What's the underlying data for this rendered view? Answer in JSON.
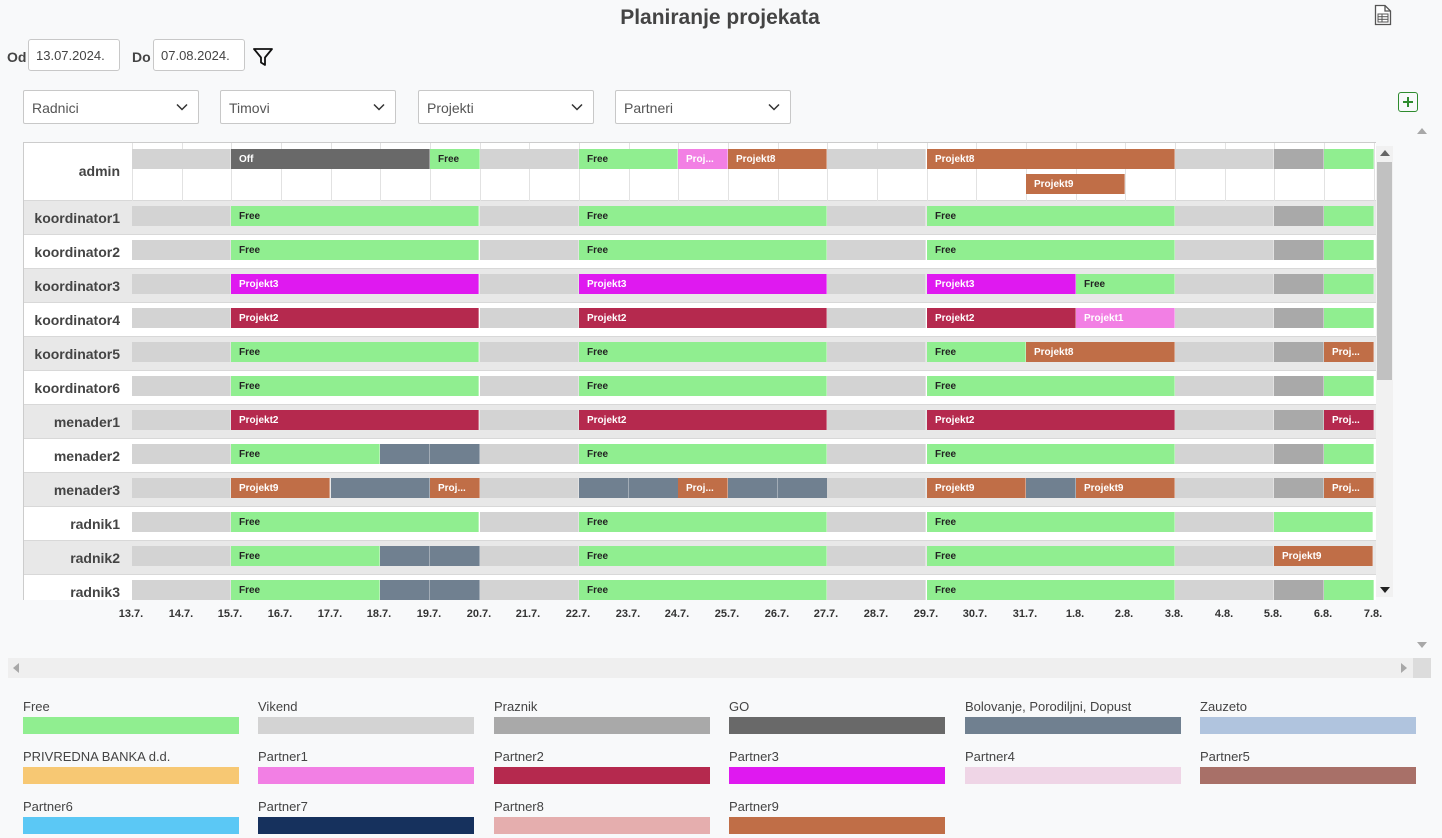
{
  "title": "Planiranje projekata",
  "icons": {
    "export": "excel-export-icon",
    "filter": "filter-icon",
    "add": "add-icon"
  },
  "filters": {
    "od_label": "Od",
    "do_label": "Do",
    "od_value": "13.07.2024.",
    "do_value": "07.08.2024.",
    "dropdowns": [
      "Radnici",
      "Timovi",
      "Projekti",
      "Partneri"
    ]
  },
  "colors": {
    "free": "#90ee90",
    "vikend": "#d3d3d3",
    "praznik": "#a9a9a9",
    "go": "#696969",
    "bolovanje": "#708090",
    "zauzeto": "#b0c4de",
    "privredna": "#f7c873",
    "partner1": "#f27fe4",
    "partner2": "#b5294e",
    "partner3": "#df19f0",
    "partner4": "#efd5e6",
    "partner5": "#a87068",
    "partner6": "#5bc8f5",
    "partner7": "#16315d",
    "partner8": "#e5aeae",
    "partner9": "#c06e47"
  },
  "axis_dates": [
    "13.7.",
    "14.7.",
    "15.7.",
    "16.7.",
    "17.7.",
    "18.7.",
    "19.7.",
    "20.7.",
    "21.7.",
    "22.7.",
    "23.7.",
    "24.7.",
    "25.7.",
    "26.7.",
    "27.7.",
    "28.7.",
    "29.7.",
    "30.7.",
    "31.7.",
    "1.8.",
    "2.8.",
    "3.8.",
    "4.8.",
    "5.8.",
    "6.8.",
    "7.8."
  ],
  "rows": [
    {
      "name": "admin",
      "lanes": [
        [
          {
            "s": 0,
            "e": 2,
            "t": "vikend",
            "l": ""
          },
          {
            "s": 2,
            "e": 6,
            "t": "go",
            "l": "Off"
          },
          {
            "s": 6,
            "e": 7,
            "t": "free",
            "l": "Free"
          },
          {
            "s": 7,
            "e": 9,
            "t": "vikend",
            "l": ""
          },
          {
            "s": 9,
            "e": 11,
            "t": "free",
            "l": "Free"
          },
          {
            "s": 11,
            "e": 12,
            "t": "partner1",
            "l": "Proj..."
          },
          {
            "s": 12,
            "e": 14,
            "t": "partner9",
            "l": "Projekt8"
          },
          {
            "s": 14,
            "e": 16,
            "t": "vikend",
            "l": ""
          },
          {
            "s": 16,
            "e": 21,
            "t": "partner9",
            "l": "Projekt8"
          },
          {
            "s": 21,
            "e": 23,
            "t": "vikend",
            "l": ""
          },
          {
            "s": 23,
            "e": 24,
            "t": "praznik",
            "l": ""
          },
          {
            "s": 24,
            "e": 25,
            "t": "free",
            "l": ""
          }
        ],
        [
          {
            "s": 18,
            "e": 20,
            "t": "partner9",
            "l": "Projekt9"
          }
        ]
      ]
    },
    {
      "name": "koordinator1",
      "lanes": [
        [
          {
            "s": 0,
            "e": 2,
            "t": "vikend",
            "l": ""
          },
          {
            "s": 2,
            "e": 7,
            "t": "free",
            "l": "Free"
          },
          {
            "s": 7,
            "e": 9,
            "t": "vikend",
            "l": ""
          },
          {
            "s": 9,
            "e": 14,
            "t": "free",
            "l": "Free"
          },
          {
            "s": 14,
            "e": 16,
            "t": "vikend",
            "l": ""
          },
          {
            "s": 16,
            "e": 21,
            "t": "free",
            "l": "Free"
          },
          {
            "s": 21,
            "e": 23,
            "t": "vikend",
            "l": ""
          },
          {
            "s": 23,
            "e": 24,
            "t": "praznik",
            "l": ""
          },
          {
            "s": 24,
            "e": 25,
            "t": "free",
            "l": ""
          }
        ]
      ]
    },
    {
      "name": "koordinator2",
      "lanes": [
        [
          {
            "s": 0,
            "e": 2,
            "t": "vikend",
            "l": ""
          },
          {
            "s": 2,
            "e": 7,
            "t": "free",
            "l": "Free"
          },
          {
            "s": 7,
            "e": 9,
            "t": "vikend",
            "l": ""
          },
          {
            "s": 9,
            "e": 14,
            "t": "free",
            "l": "Free"
          },
          {
            "s": 14,
            "e": 16,
            "t": "vikend",
            "l": ""
          },
          {
            "s": 16,
            "e": 21,
            "t": "free",
            "l": "Free"
          },
          {
            "s": 21,
            "e": 23,
            "t": "vikend",
            "l": ""
          },
          {
            "s": 23,
            "e": 24,
            "t": "praznik",
            "l": ""
          },
          {
            "s": 24,
            "e": 25,
            "t": "free",
            "l": ""
          }
        ]
      ]
    },
    {
      "name": "koordinator3",
      "lanes": [
        [
          {
            "s": 0,
            "e": 2,
            "t": "vikend",
            "l": ""
          },
          {
            "s": 2,
            "e": 7,
            "t": "partner3",
            "l": "Projekt3"
          },
          {
            "s": 7,
            "e": 9,
            "t": "vikend",
            "l": ""
          },
          {
            "s": 9,
            "e": 14,
            "t": "partner3",
            "l": "Projekt3"
          },
          {
            "s": 14,
            "e": 16,
            "t": "vikend",
            "l": ""
          },
          {
            "s": 16,
            "e": 19,
            "t": "partner3",
            "l": "Projekt3"
          },
          {
            "s": 19,
            "e": 21,
            "t": "free",
            "l": "Free"
          },
          {
            "s": 21,
            "e": 23,
            "t": "vikend",
            "l": ""
          },
          {
            "s": 23,
            "e": 24,
            "t": "praznik",
            "l": ""
          },
          {
            "s": 24,
            "e": 25,
            "t": "free",
            "l": ""
          }
        ]
      ]
    },
    {
      "name": "koordinator4",
      "lanes": [
        [
          {
            "s": 0,
            "e": 2,
            "t": "vikend",
            "l": ""
          },
          {
            "s": 2,
            "e": 7,
            "t": "partner2",
            "l": "Projekt2"
          },
          {
            "s": 7,
            "e": 9,
            "t": "vikend",
            "l": ""
          },
          {
            "s": 9,
            "e": 14,
            "t": "partner2",
            "l": "Projekt2"
          },
          {
            "s": 14,
            "e": 16,
            "t": "vikend",
            "l": ""
          },
          {
            "s": 16,
            "e": 19,
            "t": "partner2",
            "l": "Projekt2"
          },
          {
            "s": 19,
            "e": 21,
            "t": "partner1",
            "l": "Projekt1"
          },
          {
            "s": 21,
            "e": 23,
            "t": "vikend",
            "l": ""
          },
          {
            "s": 23,
            "e": 24,
            "t": "praznik",
            "l": ""
          },
          {
            "s": 24,
            "e": 25,
            "t": "free",
            "l": ""
          }
        ]
      ]
    },
    {
      "name": "koordinator5",
      "lanes": [
        [
          {
            "s": 0,
            "e": 2,
            "t": "vikend",
            "l": ""
          },
          {
            "s": 2,
            "e": 7,
            "t": "free",
            "l": "Free"
          },
          {
            "s": 7,
            "e": 9,
            "t": "vikend",
            "l": ""
          },
          {
            "s": 9,
            "e": 14,
            "t": "free",
            "l": "Free"
          },
          {
            "s": 14,
            "e": 16,
            "t": "vikend",
            "l": ""
          },
          {
            "s": 16,
            "e": 18,
            "t": "free",
            "l": "Free"
          },
          {
            "s": 18,
            "e": 21,
            "t": "partner9",
            "l": "Projekt8"
          },
          {
            "s": 21,
            "e": 23,
            "t": "vikend",
            "l": ""
          },
          {
            "s": 23,
            "e": 24,
            "t": "praznik",
            "l": ""
          },
          {
            "s": 24,
            "e": 25,
            "t": "partner9",
            "l": "Proj..."
          }
        ]
      ]
    },
    {
      "name": "koordinator6",
      "lanes": [
        [
          {
            "s": 0,
            "e": 2,
            "t": "vikend",
            "l": ""
          },
          {
            "s": 2,
            "e": 7,
            "t": "free",
            "l": "Free"
          },
          {
            "s": 7,
            "e": 9,
            "t": "vikend",
            "l": ""
          },
          {
            "s": 9,
            "e": 14,
            "t": "free",
            "l": "Free"
          },
          {
            "s": 14,
            "e": 16,
            "t": "vikend",
            "l": ""
          },
          {
            "s": 16,
            "e": 21,
            "t": "free",
            "l": "Free"
          },
          {
            "s": 21,
            "e": 23,
            "t": "vikend",
            "l": ""
          },
          {
            "s": 23,
            "e": 24,
            "t": "praznik",
            "l": ""
          },
          {
            "s": 24,
            "e": 25,
            "t": "free",
            "l": ""
          }
        ]
      ]
    },
    {
      "name": "menader1",
      "lanes": [
        [
          {
            "s": 0,
            "e": 2,
            "t": "vikend",
            "l": ""
          },
          {
            "s": 2,
            "e": 7,
            "t": "partner2",
            "l": "Projekt2"
          },
          {
            "s": 7,
            "e": 9,
            "t": "vikend",
            "l": ""
          },
          {
            "s": 9,
            "e": 14,
            "t": "partner2",
            "l": "Projekt2"
          },
          {
            "s": 14,
            "e": 16,
            "t": "vikend",
            "l": ""
          },
          {
            "s": 16,
            "e": 21,
            "t": "partner2",
            "l": "Projekt2"
          },
          {
            "s": 21,
            "e": 23,
            "t": "vikend",
            "l": ""
          },
          {
            "s": 23,
            "e": 24,
            "t": "praznik",
            "l": ""
          },
          {
            "s": 24,
            "e": 25,
            "t": "partner2",
            "l": "Proj..."
          }
        ]
      ]
    },
    {
      "name": "menader2",
      "lanes": [
        [
          {
            "s": 0,
            "e": 2,
            "t": "vikend",
            "l": ""
          },
          {
            "s": 2,
            "e": 5,
            "t": "free",
            "l": "Free"
          },
          {
            "s": 5,
            "e": 6,
            "t": "bolovanje",
            "l": ""
          },
          {
            "s": 6,
            "e": 7,
            "t": "bolovanje",
            "l": ""
          },
          {
            "s": 7,
            "e": 9,
            "t": "vikend",
            "l": ""
          },
          {
            "s": 9,
            "e": 14,
            "t": "free",
            "l": "Free"
          },
          {
            "s": 14,
            "e": 16,
            "t": "vikend",
            "l": ""
          },
          {
            "s": 16,
            "e": 21,
            "t": "free",
            "l": "Free"
          },
          {
            "s": 21,
            "e": 23,
            "t": "vikend",
            "l": ""
          },
          {
            "s": 23,
            "e": 24,
            "t": "praznik",
            "l": ""
          },
          {
            "s": 24,
            "e": 25,
            "t": "free",
            "l": ""
          }
        ]
      ]
    },
    {
      "name": "menader3",
      "lanes": [
        [
          {
            "s": 0,
            "e": 2,
            "t": "vikend",
            "l": ""
          },
          {
            "s": 2,
            "e": 4,
            "t": "partner9",
            "l": "Projekt9"
          },
          {
            "s": 4,
            "e": 5,
            "t": "bolovanje",
            "l": ""
          },
          {
            "s": 5,
            "e": 6,
            "t": "bolovanje",
            "l": ""
          },
          {
            "s": 6,
            "e": 7,
            "t": "partner9",
            "l": "Proj..."
          },
          {
            "s": 7,
            "e": 9,
            "t": "vikend",
            "l": ""
          },
          {
            "s": 9,
            "e": 10,
            "t": "bolovanje",
            "l": ""
          },
          {
            "s": 10,
            "e": 11,
            "t": "bolovanje",
            "l": ""
          },
          {
            "s": 11,
            "e": 12,
            "t": "partner9",
            "l": "Proj..."
          },
          {
            "s": 12,
            "e": 13,
            "t": "bolovanje",
            "l": ""
          },
          {
            "s": 13,
            "e": 14,
            "t": "bolovanje",
            "l": ""
          },
          {
            "s": 14,
            "e": 16,
            "t": "vikend",
            "l": ""
          },
          {
            "s": 16,
            "e": 18,
            "t": "partner9",
            "l": "Projekt9"
          },
          {
            "s": 18,
            "e": 19,
            "t": "bolovanje",
            "l": ""
          },
          {
            "s": 19,
            "e": 21,
            "t": "partner9",
            "l": "Projekt9"
          },
          {
            "s": 21,
            "e": 23,
            "t": "vikend",
            "l": ""
          },
          {
            "s": 23,
            "e": 24,
            "t": "praznik",
            "l": ""
          },
          {
            "s": 24,
            "e": 25,
            "t": "partner9",
            "l": "Proj..."
          }
        ]
      ]
    },
    {
      "name": "radnik1",
      "lanes": [
        [
          {
            "s": 0,
            "e": 2,
            "t": "vikend",
            "l": ""
          },
          {
            "s": 2,
            "e": 7,
            "t": "free",
            "l": "Free"
          },
          {
            "s": 7,
            "e": 9,
            "t": "vikend",
            "l": ""
          },
          {
            "s": 9,
            "e": 14,
            "t": "free",
            "l": "Free"
          },
          {
            "s": 14,
            "e": 16,
            "t": "vikend",
            "l": ""
          },
          {
            "s": 16,
            "e": 21,
            "t": "free",
            "l": "Free"
          },
          {
            "s": 21,
            "e": 23,
            "t": "vikend",
            "l": ""
          },
          {
            "s": 23,
            "e": 25,
            "t": "free",
            "l": ""
          }
        ]
      ]
    },
    {
      "name": "radnik2",
      "lanes": [
        [
          {
            "s": 0,
            "e": 2,
            "t": "vikend",
            "l": ""
          },
          {
            "s": 2,
            "e": 5,
            "t": "free",
            "l": "Free"
          },
          {
            "s": 5,
            "e": 6,
            "t": "bolovanje",
            "l": ""
          },
          {
            "s": 6,
            "e": 7,
            "t": "bolovanje",
            "l": ""
          },
          {
            "s": 7,
            "e": 9,
            "t": "vikend",
            "l": ""
          },
          {
            "s": 9,
            "e": 14,
            "t": "free",
            "l": "Free"
          },
          {
            "s": 14,
            "e": 16,
            "t": "vikend",
            "l": ""
          },
          {
            "s": 16,
            "e": 21,
            "t": "free",
            "l": "Free"
          },
          {
            "s": 21,
            "e": 23,
            "t": "vikend",
            "l": ""
          },
          {
            "s": 23,
            "e": 25,
            "t": "partner9",
            "l": "Projekt9"
          }
        ]
      ]
    },
    {
      "name": "radnik3",
      "lanes": [
        [
          {
            "s": 0,
            "e": 2,
            "t": "vikend",
            "l": ""
          },
          {
            "s": 2,
            "e": 5,
            "t": "free",
            "l": "Free"
          },
          {
            "s": 5,
            "e": 6,
            "t": "bolovanje",
            "l": ""
          },
          {
            "s": 6,
            "e": 7,
            "t": "bolovanje",
            "l": ""
          },
          {
            "s": 7,
            "e": 9,
            "t": "vikend",
            "l": ""
          },
          {
            "s": 9,
            "e": 14,
            "t": "free",
            "l": "Free"
          },
          {
            "s": 14,
            "e": 16,
            "t": "vikend",
            "l": ""
          },
          {
            "s": 16,
            "e": 21,
            "t": "free",
            "l": "Free"
          },
          {
            "s": 21,
            "e": 23,
            "t": "vikend",
            "l": ""
          },
          {
            "s": 23,
            "e": 24,
            "t": "praznik",
            "l": ""
          },
          {
            "s": 24,
            "e": 25,
            "t": "free",
            "l": ""
          }
        ]
      ]
    }
  ],
  "legend": [
    {
      "label": "Free",
      "color": "#90ee90"
    },
    {
      "label": "Vikend",
      "color": "#d3d3d3"
    },
    {
      "label": "Praznik",
      "color": "#a9a9a9"
    },
    {
      "label": "GO",
      "color": "#696969"
    },
    {
      "label": "Bolovanje, Porodiljni, Dopust",
      "color": "#708090"
    },
    {
      "label": "Zauzeto",
      "color": "#b0c4de"
    },
    {
      "label": "PRIVREDNA BANKA d.d.",
      "color": "#f7c873"
    },
    {
      "label": "Partner1",
      "color": "#f27fe4"
    },
    {
      "label": "Partner2",
      "color": "#b5294e"
    },
    {
      "label": "Partner3",
      "color": "#df19f0"
    },
    {
      "label": "Partner4",
      "color": "#efd5e6"
    },
    {
      "label": "Partner5",
      "color": "#a87068"
    },
    {
      "label": "Partner6",
      "color": "#5bc8f5"
    },
    {
      "label": "Partner7",
      "color": "#16315d"
    },
    {
      "label": "Partner8",
      "color": "#e5aeae"
    },
    {
      "label": "Partner9",
      "color": "#c06e47"
    }
  ]
}
